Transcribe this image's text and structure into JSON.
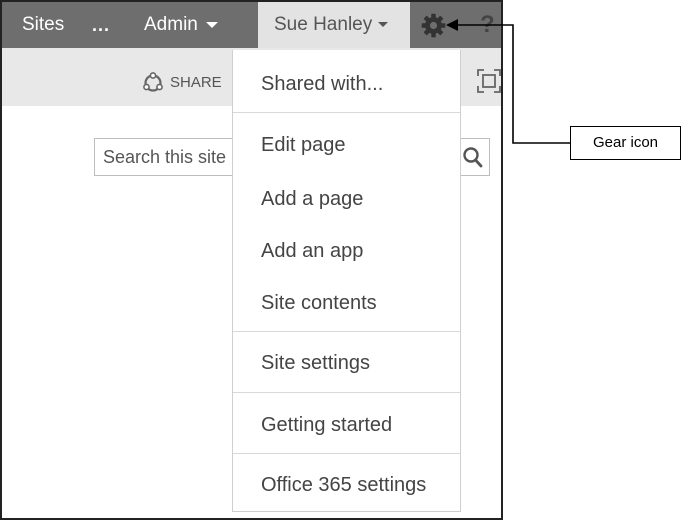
{
  "suite_bar": {
    "sites_label": "Sites",
    "more_label": "...",
    "admin_label": "Admin",
    "user_name": "Sue Hanley",
    "help_label": "?"
  },
  "ribbon": {
    "share_label": "SHARE"
  },
  "search": {
    "placeholder": "Search this site"
  },
  "settings_menu": {
    "items": [
      {
        "label": "Shared with..."
      },
      {
        "label": "Edit page"
      },
      {
        "label": "Add a page"
      },
      {
        "label": "Add an app"
      },
      {
        "label": "Site contents"
      },
      {
        "label": "Site settings"
      },
      {
        "label": "Getting started"
      },
      {
        "label": "Office 365 settings"
      }
    ]
  },
  "callout": {
    "label": "Gear icon"
  },
  "colors": {
    "suite_bar": "#6e6e6e",
    "user_tile": "#e3e3e3",
    "ribbon": "#e8e8e8"
  }
}
